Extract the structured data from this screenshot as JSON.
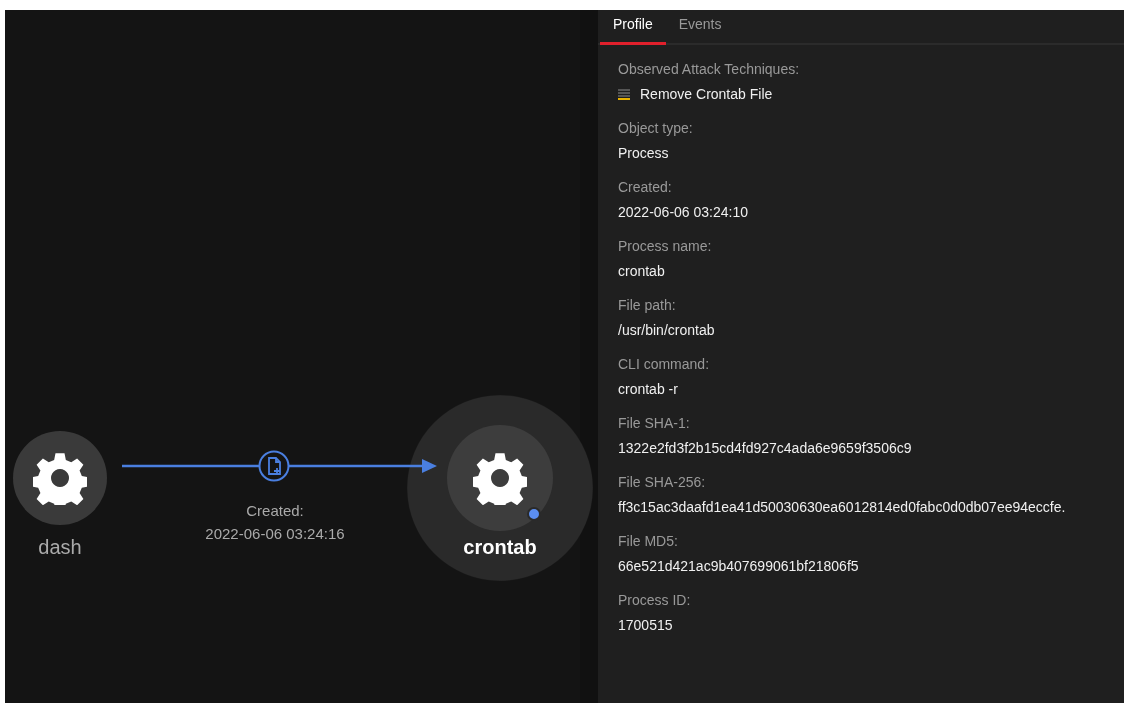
{
  "graph": {
    "nodes": [
      {
        "label": "dash",
        "selected": false,
        "dot": false
      },
      {
        "label": "crontab",
        "selected": true,
        "dot": true
      }
    ],
    "edge": {
      "label": "Created:",
      "time": "2022-06-06 03:24:16"
    }
  },
  "tabs": [
    {
      "label": "Profile",
      "selected": true
    },
    {
      "label": "Events",
      "selected": false
    }
  ],
  "techniques": {
    "label": "Observed Attack Techniques:",
    "items": [
      {
        "name": "Remove Crontab File",
        "level": 0.25
      }
    ]
  },
  "fields": [
    {
      "label": "Object type:",
      "value": "Process"
    },
    {
      "label": "Created:",
      "value": "2022-06-06 03:24:10"
    },
    {
      "label": "Process name:",
      "value": "crontab"
    },
    {
      "label": "File path:",
      "value": "/usr/bin/crontab"
    },
    {
      "label": "CLI command:",
      "value": "crontab -r"
    },
    {
      "label": "File SHA-1:",
      "value": "1322e2fd3f2b15cd4fd927c4ada6e9659f3506c9"
    },
    {
      "label": "File SHA-256:",
      "value": "ff3c15ac3daafd1ea41d50030630ea6012814ed0fabc0d0db07ee94eccfe."
    },
    {
      "label": "File MD5:",
      "value": "66e521d421ac9b407699061bf21806f5"
    },
    {
      "label": "Process ID:",
      "value": "1700515"
    }
  ]
}
